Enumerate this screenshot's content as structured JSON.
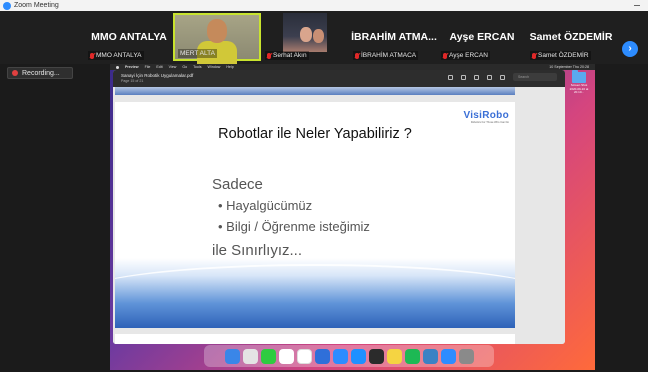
{
  "app": {
    "title": "Zoom Meeting"
  },
  "participants": [
    {
      "display_name": "MMO ANTALYA",
      "label": "MMO ANTALYA"
    },
    {
      "display_name": "",
      "label": "MERT ALTA"
    },
    {
      "display_name": "",
      "label": "Serhat Akın"
    },
    {
      "display_name": "İBRAHİM  ATMA...",
      "label": "İBRAHİM ATMACA"
    },
    {
      "display_name": "Ayşe ERCAN",
      "label": "Ayşe ERCAN"
    },
    {
      "display_name": "Samet ÖZDEMİR",
      "label": "Samet ÖZDEMİR"
    }
  ],
  "controls": {
    "next_glyph": "›",
    "recording_label": "Recording..."
  },
  "mac": {
    "menu": [
      "Preview",
      "File",
      "Edit",
      "View",
      "Go",
      "Tools",
      "Window",
      "Help"
    ],
    "clock": "10 September Thu  20:28",
    "desktop_item": "Screen Shot 2020-09-10 at 20.10..."
  },
  "preview": {
    "doc_name": "Sanayi İçin Robotik Uygulamalar.pdf",
    "page_info": "Page 15 of 21",
    "search_placeholder": "Search"
  },
  "slide": {
    "logo_text": "VisiRobo",
    "logo_tagline": "Robotics For Those Who Can Do",
    "title": "Robotlar ile Neler Yapabiliriz ?",
    "line1": "Sadece",
    "bullet1": "• Hayalgücümüz",
    "bullet2": "• Bilgi / Öğrenme isteğimiz",
    "line2": "ile Sınırlıyız..."
  },
  "dock": {
    "icons": [
      "finder-icon",
      "launchpad-icon",
      "messages-icon",
      "photos-icon",
      "calendar-icon",
      "facetime-icon",
      "zoom-icon",
      "safari-icon",
      "terminal-icon",
      "notes-icon",
      "spotify-icon",
      "preview-icon",
      "mail-icon",
      "trash-icon"
    ],
    "colors": [
      "#3a86e8",
      "#e4e4e4",
      "#2ecc40",
      "#ffffff",
      "#ffffff",
      "#2f6fd9",
      "#2d8cff",
      "#1e90ff",
      "#2b2b2b",
      "#f5d442",
      "#1db954",
      "#3b82c4",
      "#2d8cff",
      "#8a8a8a"
    ]
  },
  "colors": {
    "zoom_blue": "#2d8cff",
    "active_speaker": "#c8e32e",
    "mic_muted": "#e02828"
  }
}
